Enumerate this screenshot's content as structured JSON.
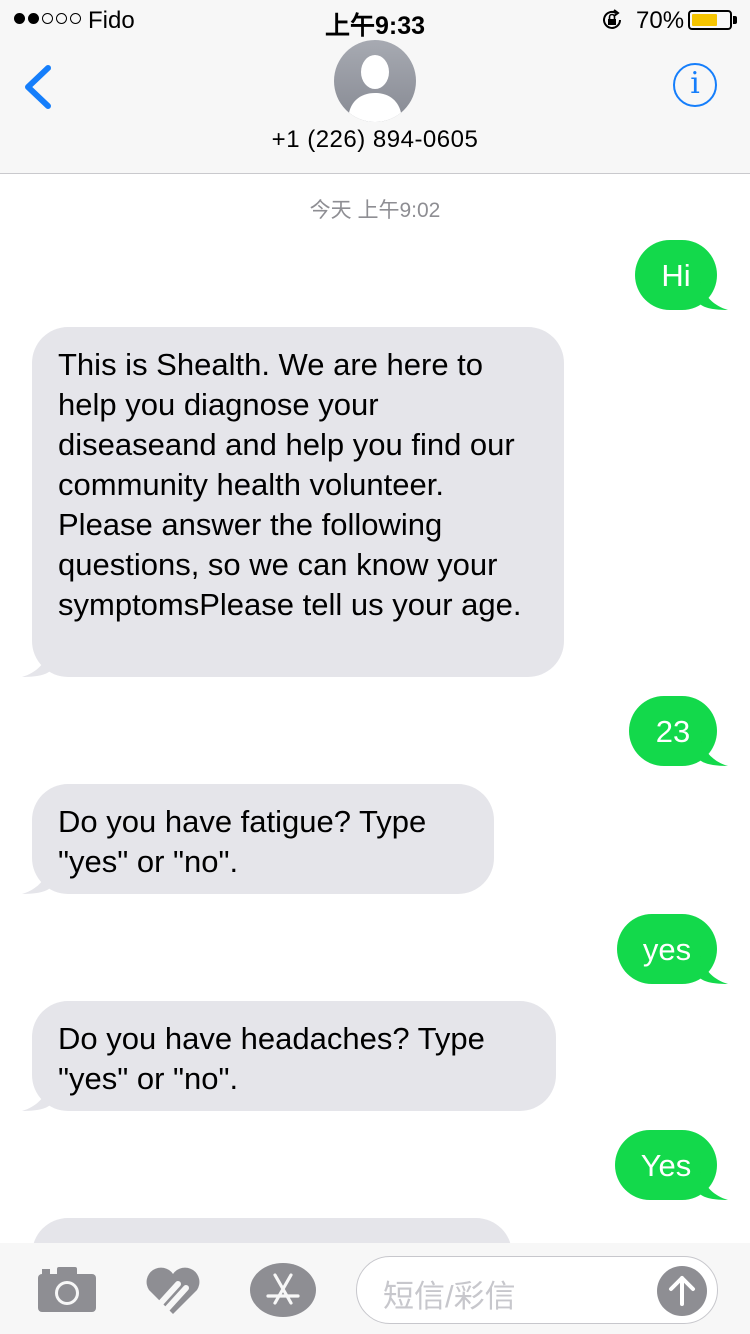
{
  "status_bar": {
    "carrier": "Fido",
    "time": "上午9:33",
    "battery_percent": "70%",
    "battery_level": 0.7,
    "signal_bars_filled": 2,
    "signal_bars_total": 5
  },
  "header": {
    "contact": "+1 (226) 894-0605",
    "info_label": "i"
  },
  "conversation": {
    "timestamp": "今天 上午9:02",
    "messages": [
      {
        "direction": "outgoing",
        "text": "Hi"
      },
      {
        "direction": "incoming",
        "text": "This is Shealth. We are here to help you diagnose your diseaseand and help you find our community health volunteer. Please answer the following questions, so we can know your symptomsPlease tell us your age."
      },
      {
        "direction": "outgoing",
        "text": "23"
      },
      {
        "direction": "incoming",
        "text": "Do you have fatigue? Type \"yes\" or \"no\"."
      },
      {
        "direction": "outgoing",
        "text": "yes"
      },
      {
        "direction": "incoming",
        "text": "Do you have headaches? Type \"yes\" or \"no\"."
      },
      {
        "direction": "outgoing",
        "text": "Yes"
      },
      {
        "direction": "incoming",
        "text": ""
      }
    ]
  },
  "input_bar": {
    "placeholder": "短信/彩信",
    "icons": [
      "camera-icon",
      "digital-touch-icon",
      "app-store-icon",
      "send-arrow-icon"
    ]
  },
  "colors": {
    "outgoing_bubble": "#13d94b",
    "incoming_bubble": "#e5e5ea",
    "accent": "#157efb",
    "battery": "#f5c400"
  }
}
